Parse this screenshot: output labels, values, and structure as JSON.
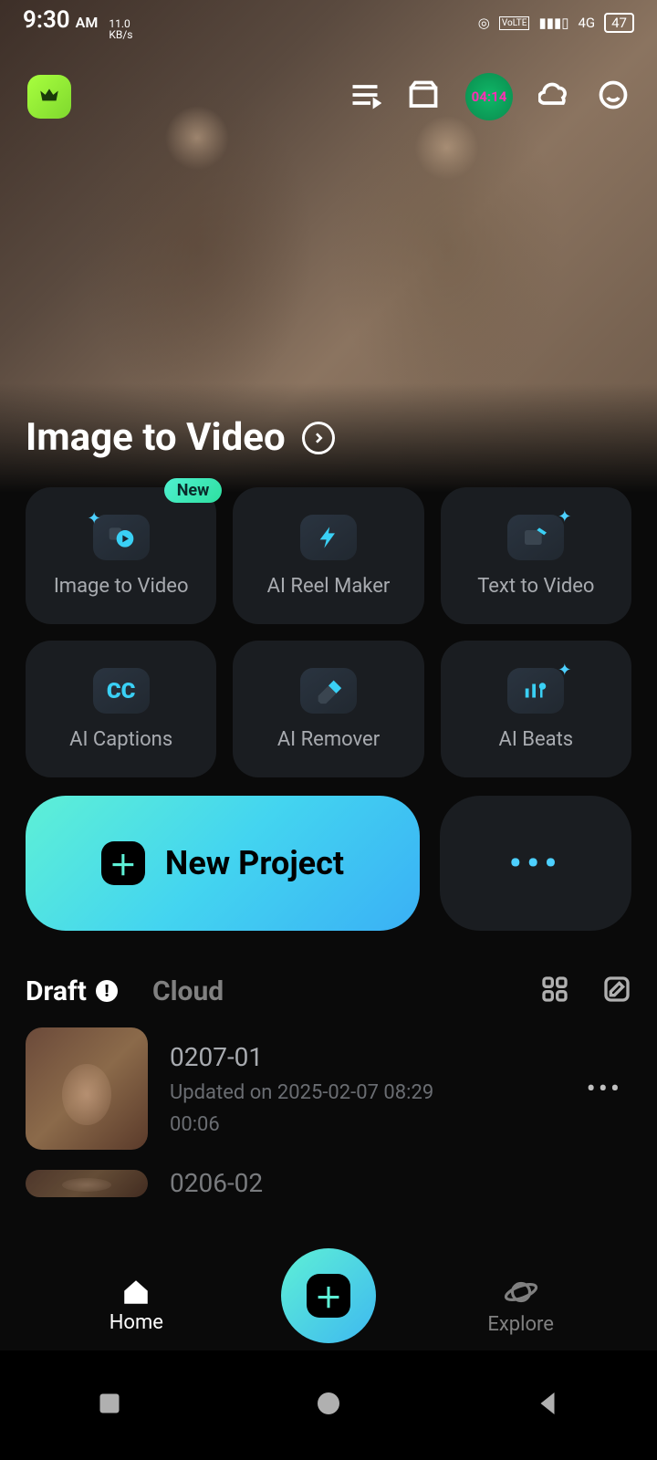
{
  "status": {
    "time": "9:30",
    "ampm": "AM",
    "net_speed_top": "11.0",
    "net_speed_bottom": "KB/s",
    "network_label": "4G",
    "volte": "VoLTE",
    "battery": "47"
  },
  "sync_timer": "04:14",
  "hero": {
    "title": "Image to Video"
  },
  "tools": [
    {
      "label": "Image to Video",
      "badge": "New"
    },
    {
      "label": "AI Reel Maker",
      "badge": null
    },
    {
      "label": "Text to Video",
      "badge": null
    },
    {
      "label": "AI Captions",
      "badge": null
    },
    {
      "label": "AI Remover",
      "badge": null
    },
    {
      "label": "AI Beats",
      "badge": null
    }
  ],
  "actions": {
    "new_project": "New Project",
    "more": "•••"
  },
  "tabs": {
    "draft": "Draft",
    "cloud": "Cloud"
  },
  "drafts": [
    {
      "name": "0207-01",
      "updated": "Updated on 2025-02-07 08:29",
      "duration": "00:06"
    },
    {
      "name": "0206-02",
      "updated": "",
      "duration": ""
    }
  ],
  "nav": {
    "home": "Home",
    "explore": "Explore"
  }
}
